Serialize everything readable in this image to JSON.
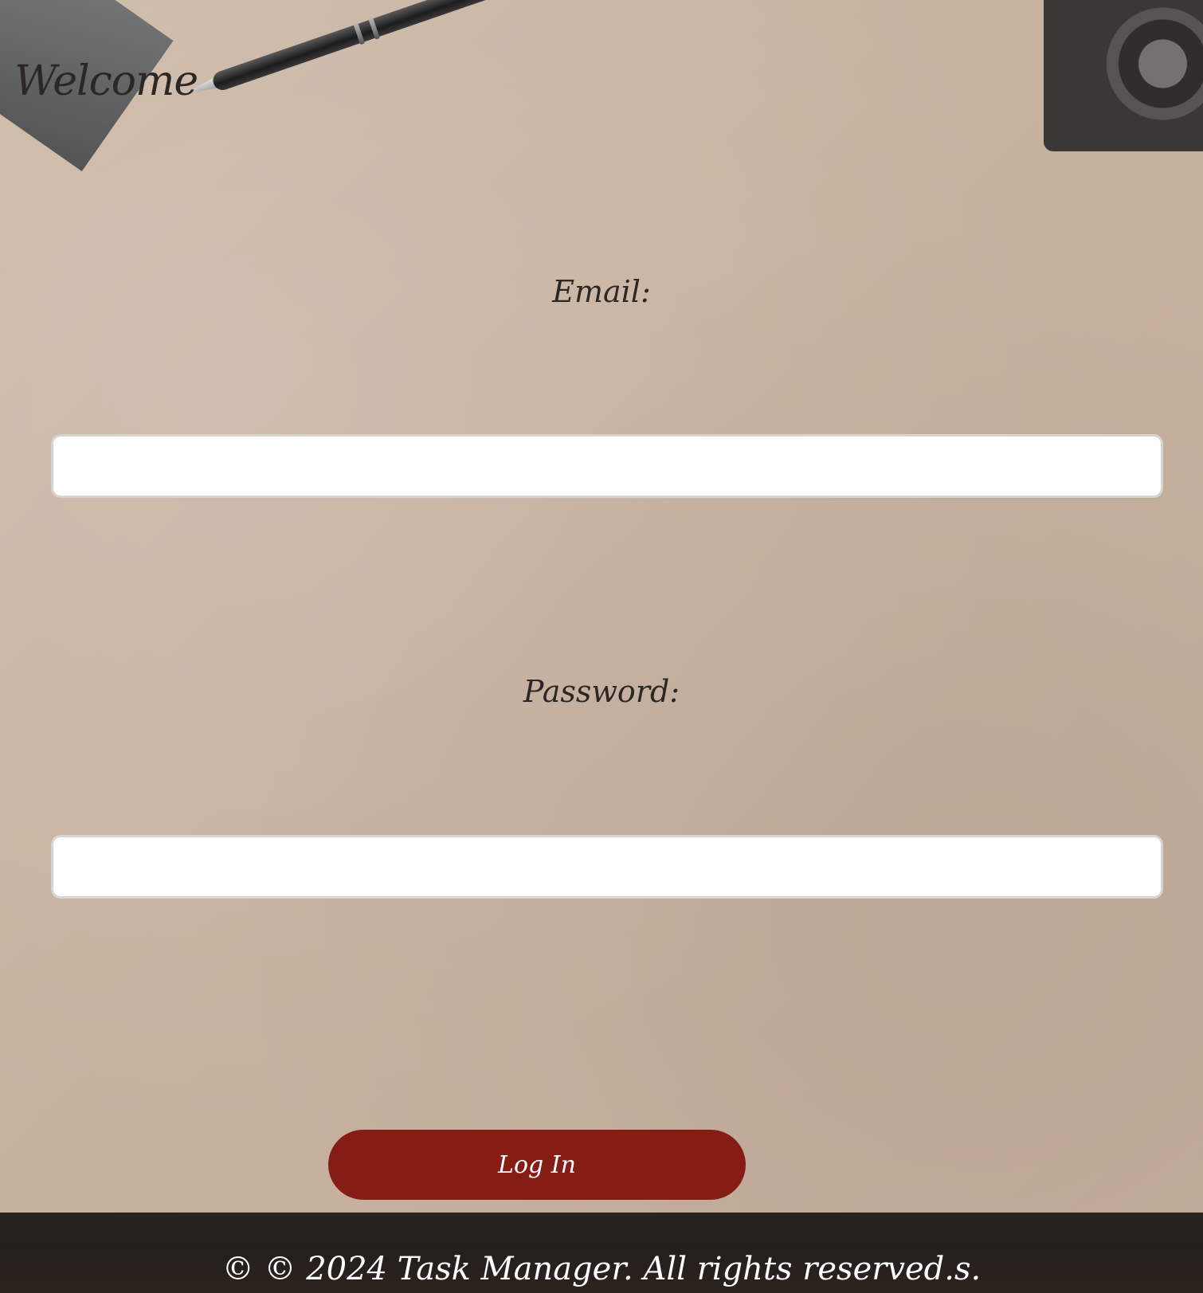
{
  "header": {
    "title": "Welcome"
  },
  "login_form": {
    "email_label": "Email:",
    "email_value": "",
    "password_label": "Password:",
    "password_value": "",
    "submit_label": "Log In"
  },
  "footer": {
    "text": "© © 2024 Task Manager. All rights reserved.s."
  },
  "colors": {
    "button_bg": "#861d15",
    "footer_bg": "#241f1c",
    "page_bg": "#c9b5a3",
    "text_dark": "#2a2724"
  }
}
